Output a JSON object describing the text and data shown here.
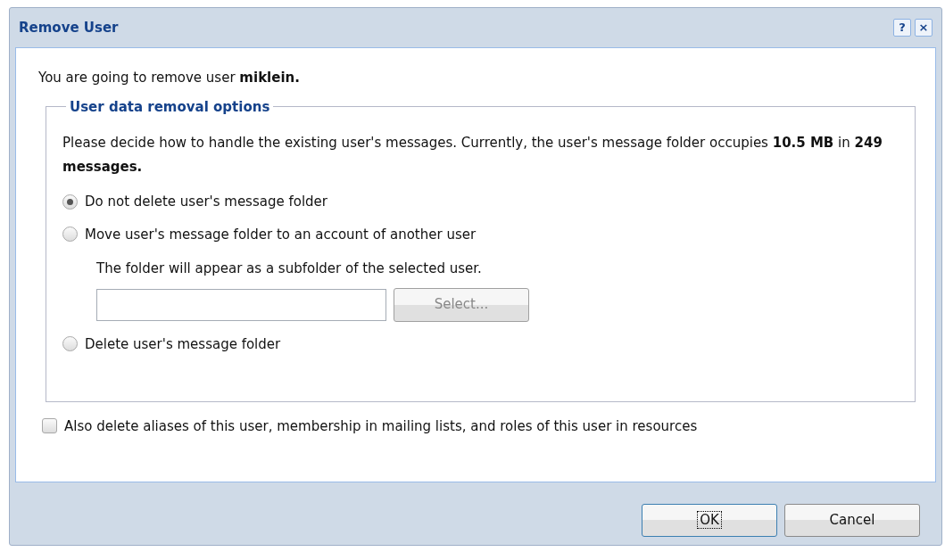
{
  "window": {
    "title": "Remove User",
    "help_button": "?",
    "close_button": "×"
  },
  "intro": "You are going to remove user **miklein.**",
  "group": {
    "legend": "User data removal options",
    "description": "Please decide how to handle the existing user's messages. Currently, the user's message folder occupies **10.5 MB** in **249 messages.**",
    "options": [
      {
        "label": "Do not delete user's message folder",
        "selected": true
      },
      {
        "label": "Move user's message folder to an account of another user",
        "selected": false,
        "hint": "The folder will appear as a subfolder of the selected user.",
        "select_button": {
          "label": "Select...",
          "disabled": true
        }
      },
      {
        "label": "Delete user's message folder",
        "selected": false
      }
    ]
  },
  "also_delete": {
    "label": "Also delete aliases of this user, membership in mailing lists, and roles of this user in resources",
    "checked": false
  },
  "buttons": [
    {
      "label": "OK",
      "focused": true
    },
    {
      "label": "Cancel",
      "focused": false
    }
  ]
}
